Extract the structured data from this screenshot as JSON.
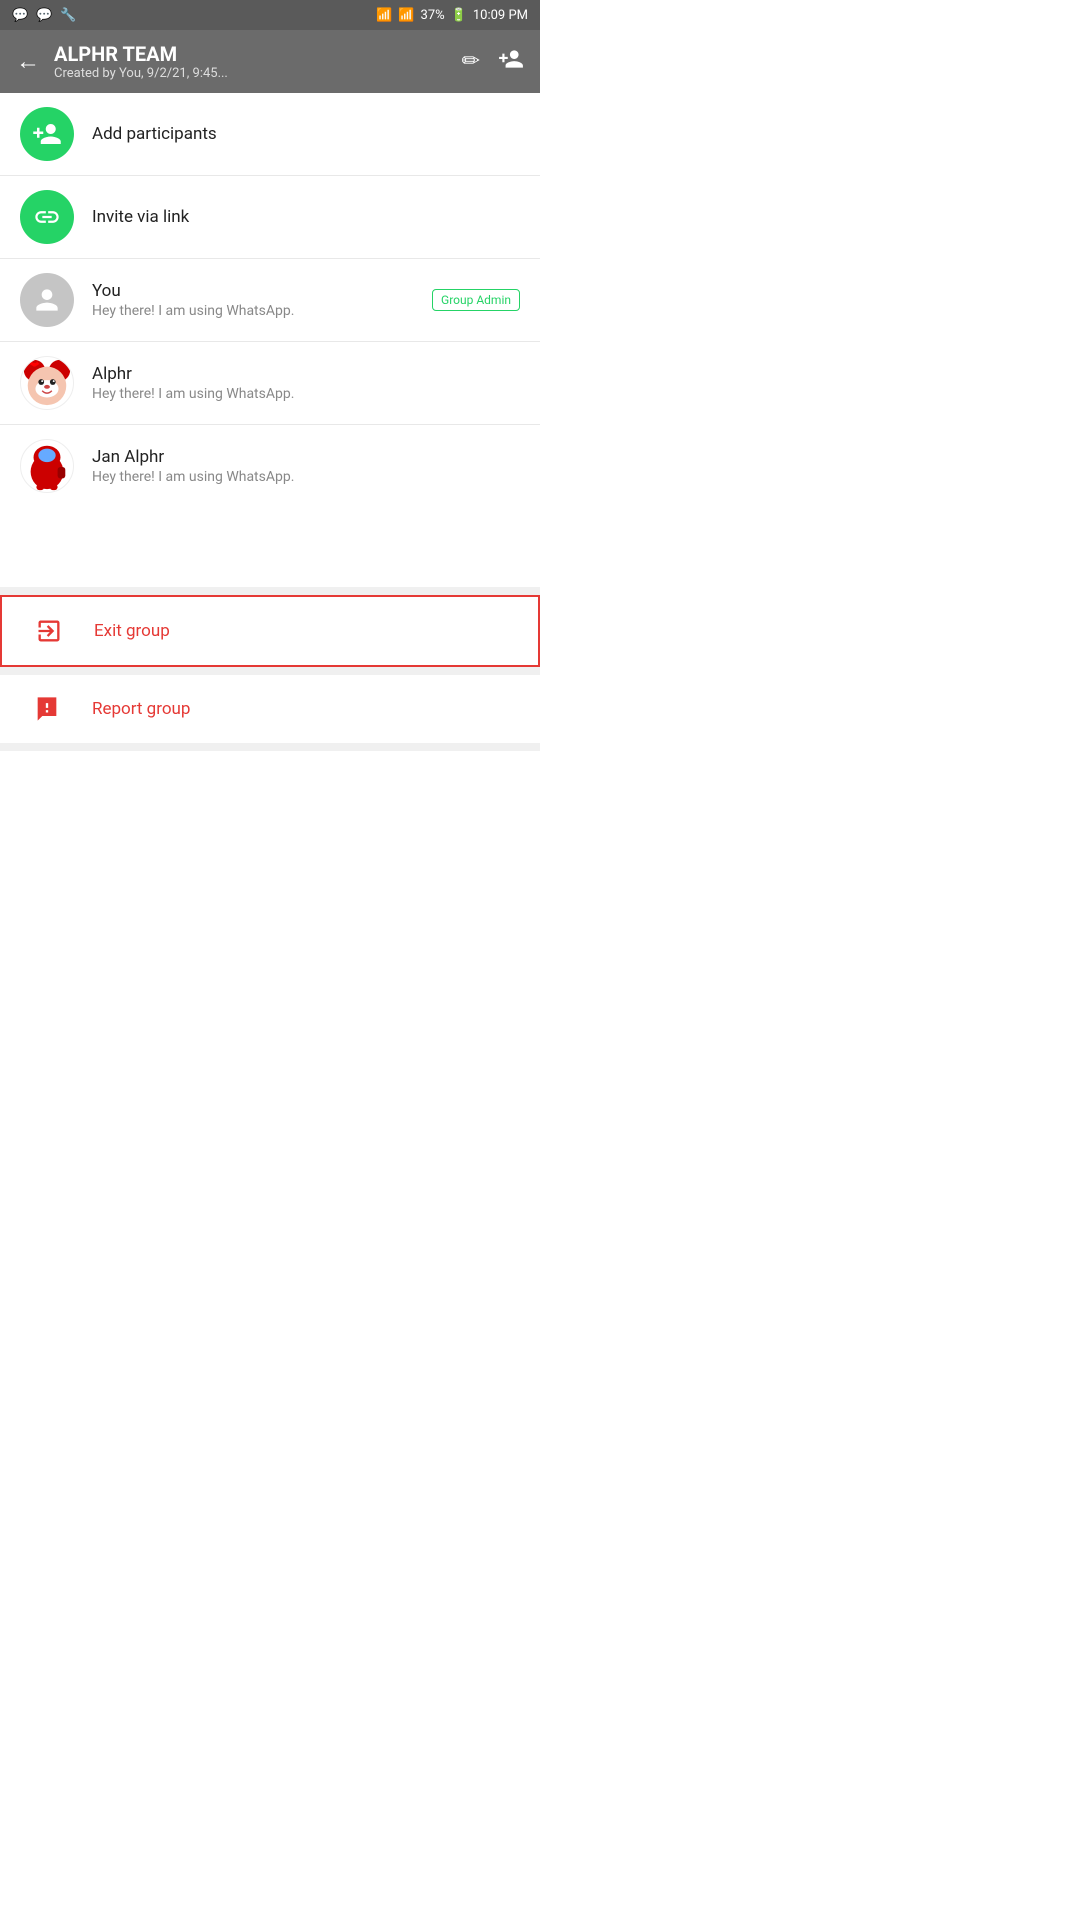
{
  "statusBar": {
    "leftIcons": [
      "💬",
      "💬",
      "🔧"
    ],
    "wifi": "📶",
    "signal": "📶",
    "battery": "37%",
    "batteryIcon": "🔋",
    "time": "10:09 PM"
  },
  "header": {
    "backLabel": "←",
    "title": "ALPHR TEAM",
    "subtitle": "Created by You, 9/2/21, 9:45...",
    "editIcon": "✏",
    "addPersonIcon": "👤"
  },
  "listItems": [
    {
      "id": "add-participants",
      "icon": "add-user",
      "name": "Add participants",
      "sub": "",
      "badge": null,
      "avatarType": "green"
    },
    {
      "id": "invite-link",
      "icon": "link",
      "name": "Invite via link",
      "sub": "",
      "badge": null,
      "avatarType": "green"
    },
    {
      "id": "you",
      "icon": "person",
      "name": "You",
      "sub": "Hey there! I am using WhatsApp.",
      "badge": "Group Admin",
      "avatarType": "gray"
    },
    {
      "id": "alphr",
      "icon": "minnie",
      "name": "Alphr",
      "sub": "Hey there! I am using WhatsApp.",
      "badge": null,
      "avatarType": "minnie"
    },
    {
      "id": "jan-alphr",
      "icon": "among",
      "name": "Jan Alphr",
      "sub": "Hey there! I am using WhatsApp.",
      "badge": null,
      "avatarType": "among"
    }
  ],
  "actions": [
    {
      "id": "exit-group",
      "label": "Exit group",
      "icon": "exit",
      "highlighted": true
    },
    {
      "id": "report-group",
      "label": "Report group",
      "icon": "report",
      "highlighted": false
    }
  ]
}
